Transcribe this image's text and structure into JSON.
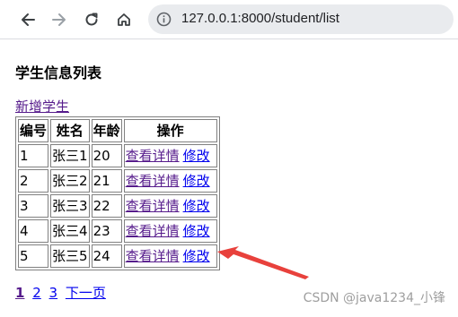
{
  "browser": {
    "url": "127.0.0.1:8000/student/list",
    "icons": {
      "back": "back-arrow-icon",
      "forward": "forward-arrow-icon",
      "reload": "reload-icon",
      "home": "home-icon",
      "site_info": "site-info-icon"
    }
  },
  "page": {
    "title": "学生信息列表",
    "add_link": "新增学生",
    "table": {
      "headers": [
        "编号",
        "姓名",
        "年龄",
        "操作"
      ],
      "rows": [
        {
          "id": "1",
          "name": "张三1",
          "age": "20",
          "detail": "查看详情",
          "edit": "修改"
        },
        {
          "id": "2",
          "name": "张三2",
          "age": "21",
          "detail": "查看详情",
          "edit": "修改"
        },
        {
          "id": "3",
          "name": "张三3",
          "age": "22",
          "detail": "查看详情",
          "edit": "修改"
        },
        {
          "id": "4",
          "name": "张三4",
          "age": "23",
          "detail": "查看详情",
          "edit": "修改"
        },
        {
          "id": "5",
          "name": "张三5",
          "age": "24",
          "detail": "查看详情",
          "edit": "修改"
        }
      ]
    },
    "pagination": {
      "pages": [
        "1",
        "2",
        "3"
      ],
      "next": "下一页"
    }
  },
  "watermark": "CSDN @java1234_小锋",
  "colors": {
    "link": "#0000ee",
    "visited_link": "#551a8b",
    "arrow": "#e8413c",
    "urlbar": "#e9ebee"
  }
}
